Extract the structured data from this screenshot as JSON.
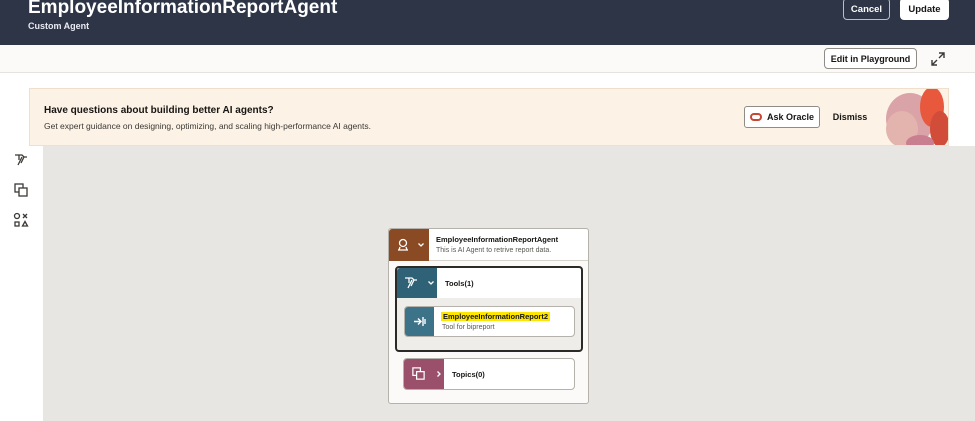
{
  "header": {
    "title": "EmployeeInformationReportAgent",
    "subtitle": "Custom Agent",
    "cancel_label": "Cancel",
    "update_label": "Update"
  },
  "toolbar": {
    "playground_label": "Edit in Playground",
    "expand_icon": "expand-icon"
  },
  "banner": {
    "title": "Have questions about building better AI agents?",
    "text": "Get expert guidance on designing, optimizing, and scaling high-performance AI agents.",
    "ask_label": "Ask Oracle",
    "dismiss_label": "Dismiss"
  },
  "rail": {
    "icons": [
      "tools-icon",
      "topics-icon",
      "shapes-icon"
    ]
  },
  "agent": {
    "name": "EmployeeInformationReportAgent",
    "description": "This is AI Agent to retrive report data.",
    "tools_label": "Tools(1)",
    "tool": {
      "name": "EmployeeInformationReport2",
      "description": "Tool for bipreport"
    },
    "topics_label": "Topics(0)"
  },
  "colors": {
    "header_bg": "#2e3547",
    "banner_bg": "#fcf2e6",
    "agent_accent": "#8a4a24",
    "tools_accent": "#2f6177",
    "tool_accent": "#3d7389",
    "topics_accent": "#9a4f6a",
    "highlight": "#ffe600",
    "oracle_red": "#c74634"
  }
}
